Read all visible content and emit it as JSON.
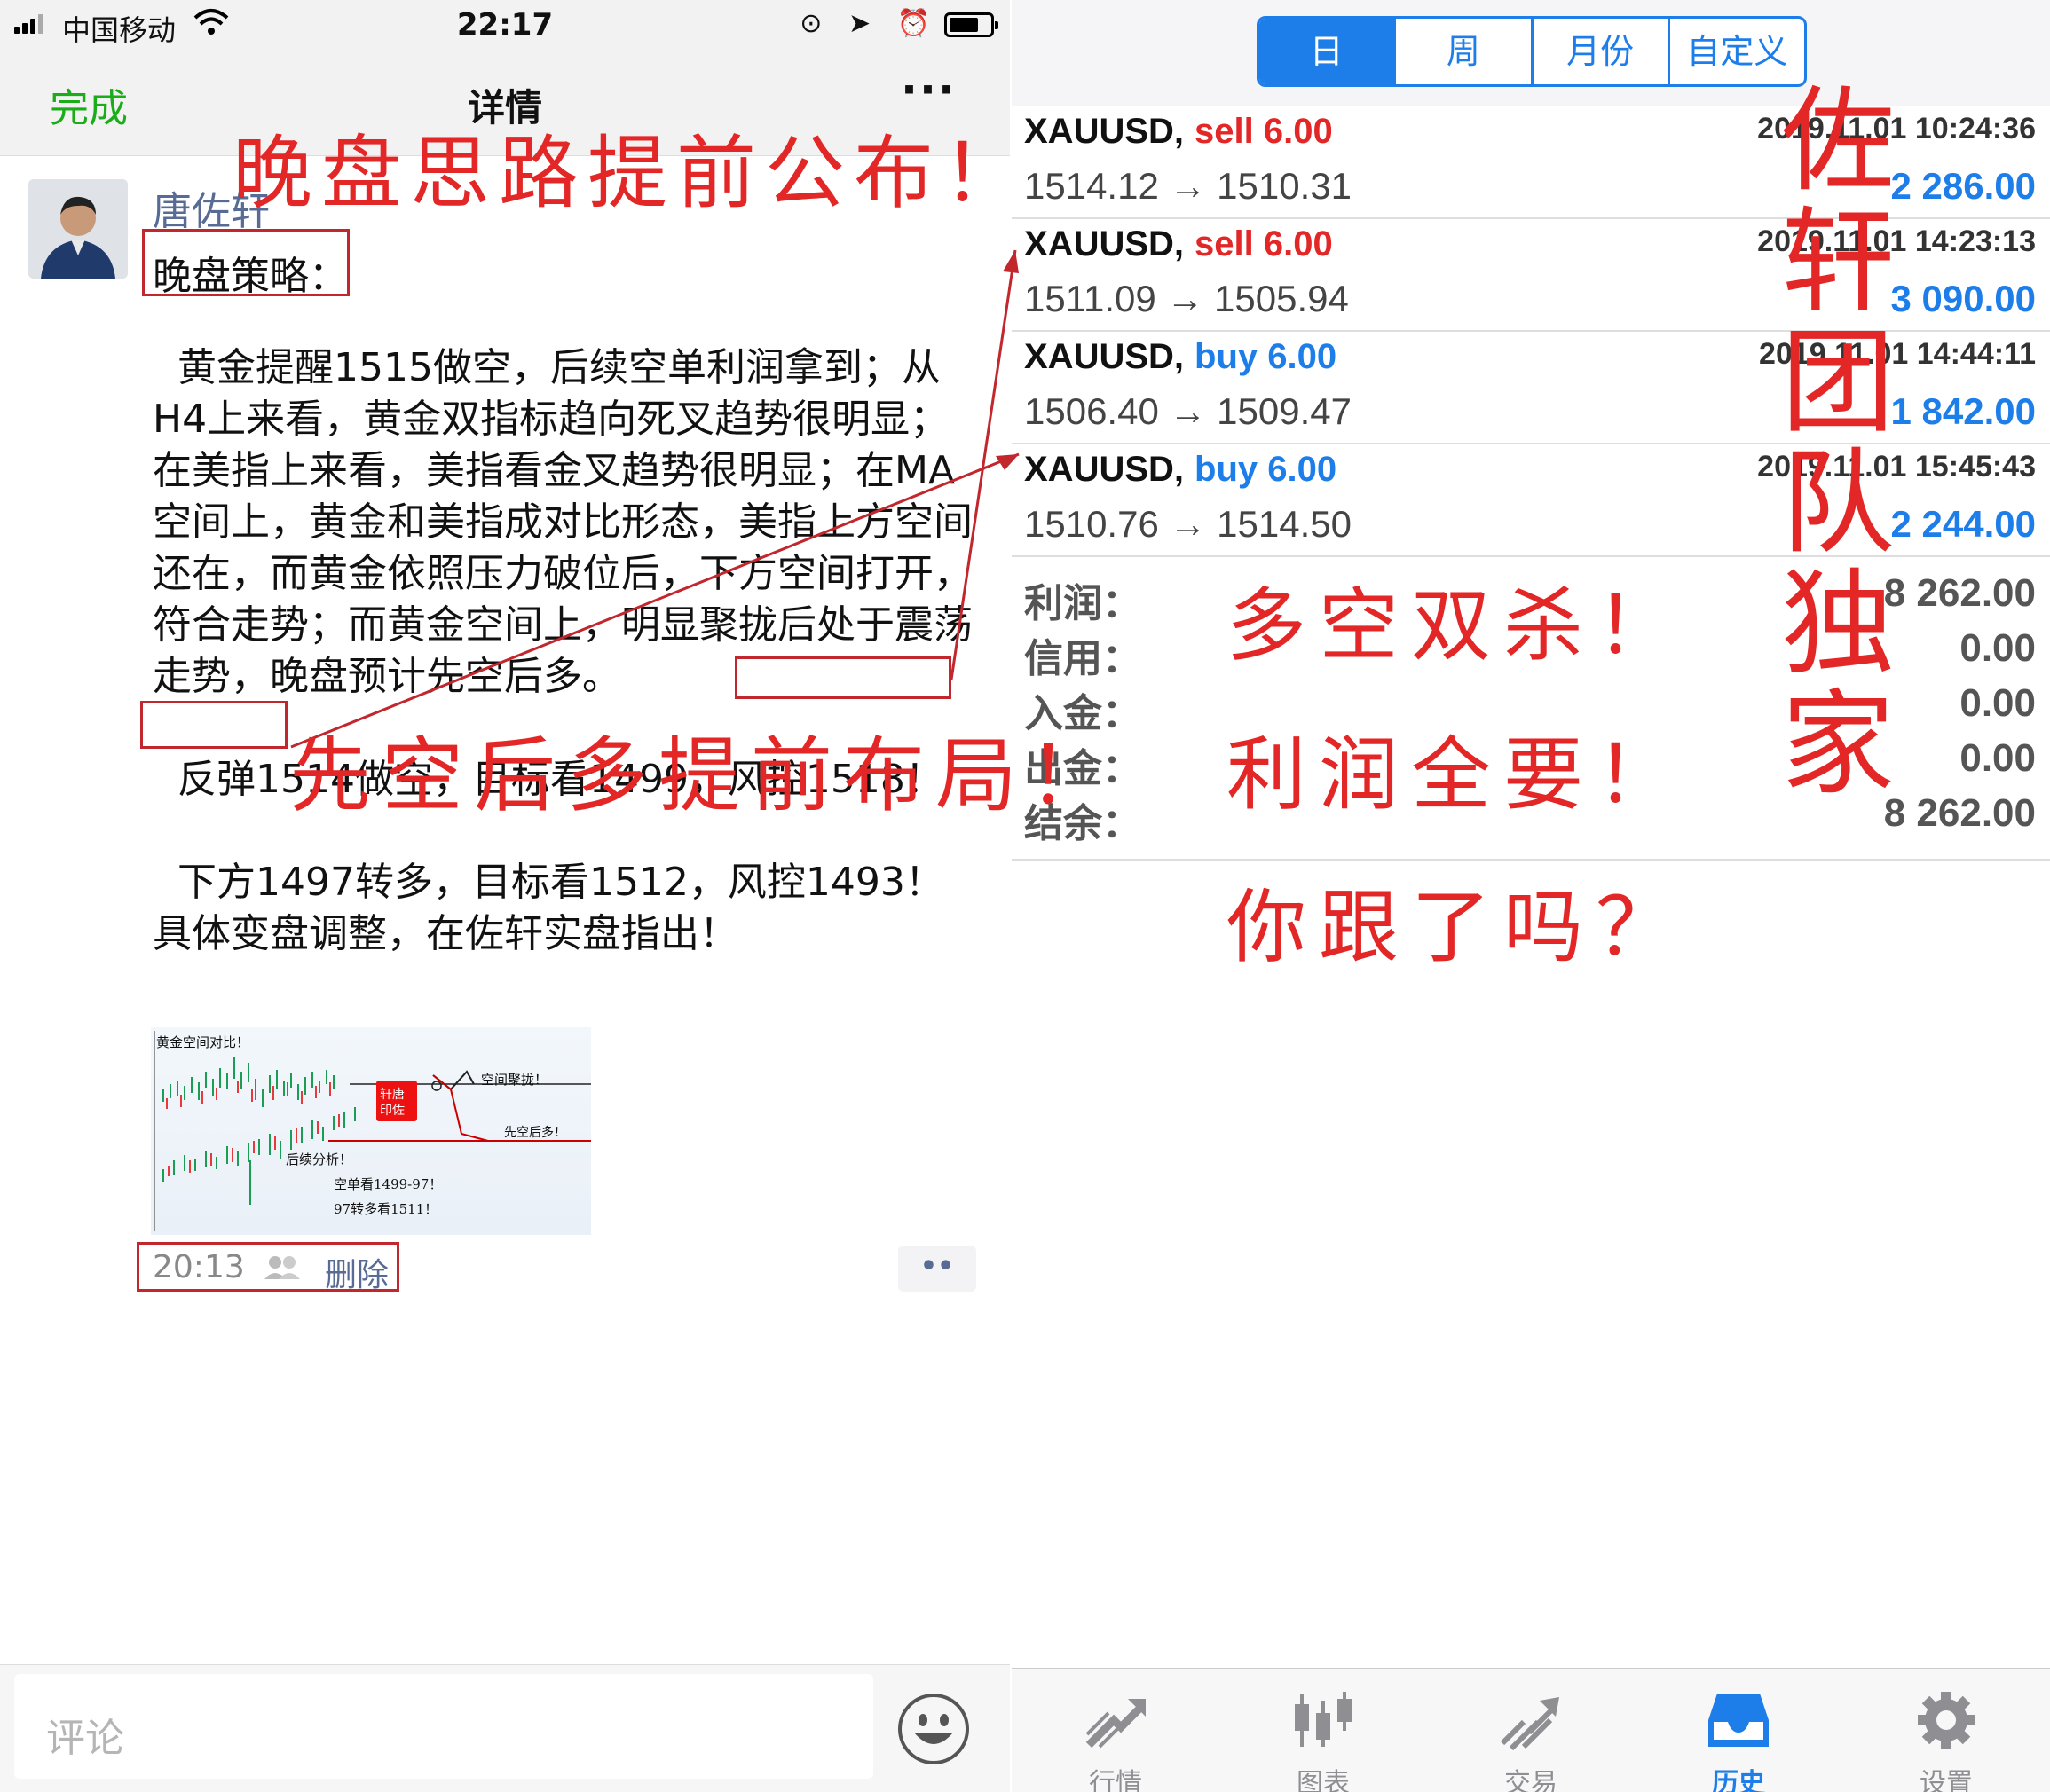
{
  "status_bar": {
    "carrier": "中国移动",
    "time": "22:17",
    "icons": "⊙ ➤ ⏰"
  },
  "navbar": {
    "done": "完成",
    "title": "详情",
    "more": "···"
  },
  "post": {
    "author": "唐佐轩",
    "strategy_title": "晚盘策略：",
    "body": "  黄金提醒1515做空，后续空单利润拿到；从H4上来看，黄金双指标趋向死叉趋势很明显；在美指上来看，美指看金叉趋势很明显；在MA空间上，黄金和美指成对比形态，美指上方空间还在，而黄金依照压力破位后，下方空间打开，符合走势；而黄金空间上，明显聚拢后处于震荡走势，晚盘预计先空后多。\n\n  反弹1514做空，目标看1499，风控1518！\n\n  下方1497转多，目标看1512，风控1493！具体变盘调整，在佐轩实盘指出！",
    "image_notes": {
      "top": "黄金空间对比！",
      "gather": "空间聚拢！",
      "short_long": "先空后多！",
      "follow": "后续分析！",
      "short_target": "空单看1499-97！",
      "long_target": "97转多看1511！",
      "seal": "轩唐印佐"
    },
    "time": "20:13",
    "delete": "删除",
    "comment_dots": "••"
  },
  "comment_bar": {
    "placeholder": "评论"
  },
  "history": {
    "periods": [
      "日",
      "周",
      "月份",
      "自定义"
    ],
    "active_period": "日",
    "deals": [
      {
        "symbol": "XAUUSD,",
        "side": "sell 6.00",
        "side_color": "#e32626",
        "prices": "1514.12 → 1510.31",
        "time": "2019.11.01 10:24:36",
        "profit": "2 286.00"
      },
      {
        "symbol": "XAUUSD,",
        "side": "sell 6.00",
        "side_color": "#e32626",
        "prices": "1511.09 → 1505.94",
        "time": "2019.11.01 14:23:13",
        "profit": "3 090.00"
      },
      {
        "symbol": "XAUUSD,",
        "side": "buy 6.00",
        "side_color": "#1d7eea",
        "prices": "1506.40 → 1509.47",
        "time": "2019.11.01 14:44:11",
        "profit": "1 842.00"
      },
      {
        "symbol": "XAUUSD,",
        "side": "buy 6.00",
        "side_color": "#1d7eea",
        "prices": "1510.76 → 1514.50",
        "time": "2019.11.01 15:45:43",
        "profit": "2 244.00"
      }
    ],
    "summary": [
      {
        "label": "利润：",
        "value": "8 262.00"
      },
      {
        "label": "信用：",
        "value": "0.00"
      },
      {
        "label": "入金：",
        "value": "0.00"
      },
      {
        "label": "出金：",
        "value": "0.00"
      },
      {
        "label": "结余：",
        "value": "8 262.00"
      }
    ],
    "tabs": [
      {
        "label": "行情",
        "icon": "quotes-icon"
      },
      {
        "label": "图表",
        "icon": "chart-icon"
      },
      {
        "label": "交易",
        "icon": "trade-icon"
      },
      {
        "label": "历史",
        "icon": "history-icon"
      },
      {
        "label": "设置",
        "icon": "settings-icon"
      }
    ],
    "active_tab": "历史"
  },
  "annotations": {
    "headline": "晚盘思路提前公布！",
    "plan": "先空后多提前布局！",
    "line1": "多空双杀！",
    "line2": "利润全要！",
    "line3": "你跟了吗？",
    "vertical": [
      "佐",
      "轩",
      "团",
      "队",
      "独",
      "家"
    ]
  },
  "colors": {
    "wechat_green": "#1aad19",
    "link_blue": "#576b95",
    "mt4_blue": "#1d7eea",
    "sell_red": "#e32626",
    "annotation_red": "#e32626",
    "box_red": "#c1272d"
  }
}
